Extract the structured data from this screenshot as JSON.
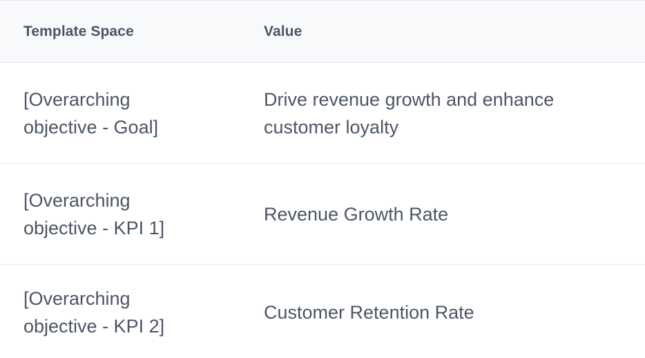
{
  "table": {
    "headers": [
      "Template Space",
      "Value"
    ],
    "rows": [
      {
        "template": "[Overarching objective - Goal]",
        "value": "Drive revenue growth and enhance customer loyalty"
      },
      {
        "template": "[Overarching objective - KPI 1]",
        "value": "Revenue Growth Rate"
      },
      {
        "template": "[Overarching objective - KPI 2]",
        "value": "Customer Retention Rate"
      }
    ]
  }
}
